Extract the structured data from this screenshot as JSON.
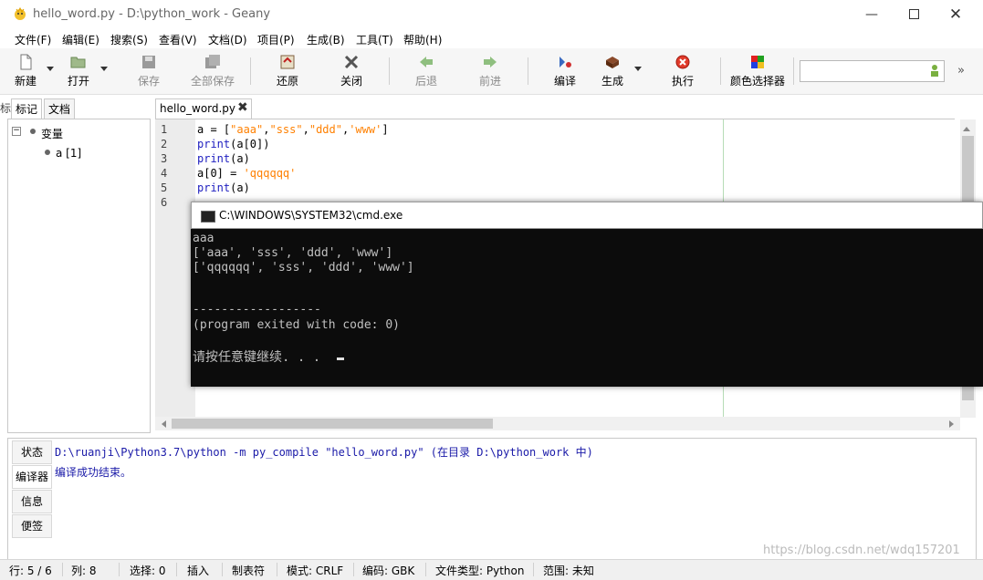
{
  "window": {
    "title": "hello_word.py - D:\\python_work - Geany"
  },
  "menu": [
    "文件(F)",
    "编辑(E)",
    "搜索(S)",
    "查看(V)",
    "文档(D)",
    "项目(P)",
    "生成(B)",
    "工具(T)",
    "帮助(H)"
  ],
  "toolbar": {
    "new": "新建",
    "open": "打开",
    "save": "保存",
    "save_all": "全部保存",
    "revert": "还原",
    "close": "关闭",
    "back": "后退",
    "forward": "前进",
    "compile": "编译",
    "build": "生成",
    "execute": "执行",
    "color_picker": "颜色选择器",
    "more": "»"
  },
  "sidebar": {
    "tabs": [
      "标记",
      "文档"
    ],
    "tree_root": "变量",
    "tree_item": "a [1]",
    "cut_text": "标"
  },
  "editor": {
    "tab_label": "hello_word.py",
    "line_numbers": [
      "1",
      "2",
      "3",
      "4",
      "5",
      "6"
    ]
  },
  "cmd": {
    "title": "C:\\WINDOWS\\SYSTEM32\\cmd.exe",
    "lines": [
      "aaa",
      "['aaa', 'sss', 'ddd', 'www']",
      "['qqqqqq', 'sss', 'ddd', 'www']",
      "",
      "",
      "------------------",
      "(program exited with code: 0)",
      "",
      "请按任意键继续. . ."
    ]
  },
  "messages": {
    "tabs": [
      "状态",
      "编译器",
      "信息",
      "便签"
    ],
    "lines": [
      "D:\\ruanji\\Python3.7\\python -m py_compile \"hello_word.py\" (在目录 D:\\python_work 中)",
      "编译成功结束。"
    ]
  },
  "status": {
    "row": "行: 5 / 6",
    "col": "列: 8",
    "sel": "选择: 0",
    "insert": "插入",
    "tab": "制表符",
    "mode": "模式: CRLF",
    "encoding": "编码: GBK",
    "filetype": "文件类型: Python",
    "scope": "范围: 未知"
  },
  "watermark": "https://blog.csdn.net/wdq157201"
}
